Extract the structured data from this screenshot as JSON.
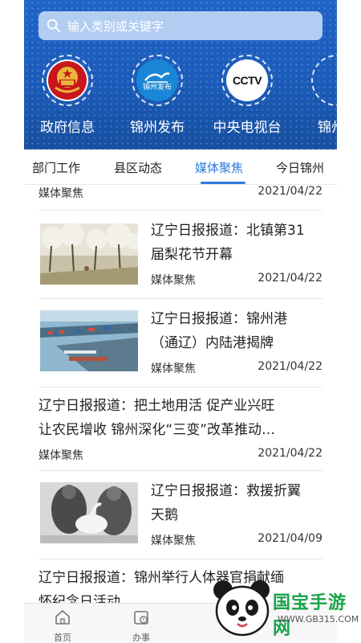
{
  "search": {
    "placeholder": "输入类别或关键字"
  },
  "channels": [
    {
      "label": "政府信息",
      "icon": "emblem-icon"
    },
    {
      "label": "锦州发布",
      "icon": "jinzhou-release-logo",
      "logo_text": "锦州发布"
    },
    {
      "label": "中央电视台",
      "icon": "cctv-logo",
      "logo_text": "CCTV"
    },
    {
      "label": "锦州"
    }
  ],
  "tabs": [
    {
      "label": "部门工作",
      "active": false
    },
    {
      "label": "县区动态",
      "active": false
    },
    {
      "label": "媒体聚焦",
      "active": true
    },
    {
      "label": "今日锦州",
      "active": false
    }
  ],
  "news": [
    {
      "title": "",
      "source": "媒体聚焦",
      "date": "2021/04/22",
      "has_image": false
    },
    {
      "title": "辽宁日报报道：北镇第31届梨花节开幕",
      "title_lines": [
        "辽宁日报报道：北镇第31",
        "届梨花节开幕"
      ],
      "source": "媒体聚焦",
      "date": "2021/04/22",
      "has_image": true,
      "image": "pear-orchard-photo"
    },
    {
      "title": "辽宁日报报道：锦州港（通辽）内陆港揭牌",
      "title_lines": [
        "辽宁日报报道：锦州港",
        "（通辽）内陆港揭牌"
      ],
      "source": "媒体聚焦",
      "date": "2021/04/22",
      "has_image": true,
      "image": "port-aerial-photo"
    },
    {
      "title": "辽宁日报报道：把土地用活 促产业兴旺 让农民增收 锦州深化“三变”改革推动…",
      "title_lines": [
        "辽宁日报报道：把土地用活 促产业兴旺",
        "让农民增收 锦州深化“三变”改革推动…"
      ],
      "source": "媒体聚焦",
      "date": "2021/04/22",
      "has_image": false
    },
    {
      "title": "辽宁日报报道：救援折翼天鹅",
      "title_lines": [
        "辽宁日报报道：救援折翼",
        "天鹅"
      ],
      "source": "媒体聚焦",
      "date": "2021/04/09",
      "has_image": true,
      "image": "swan-rescue-photo"
    },
    {
      "title": "辽宁日报报道：锦州举行人体器官捐献缅怀纪念日活动",
      "title_lines": [
        "辽宁日报报道：锦州举行人体器官捐献缅",
        "怀纪念日活动"
      ],
      "source": "",
      "date": "",
      "has_image": false
    }
  ],
  "bottom_nav": [
    {
      "label": "首页",
      "icon": "home-icon"
    },
    {
      "label": "办事",
      "icon": "service-icon"
    }
  ],
  "watermark": {
    "brand": "国宝手游网",
    "url": "WWW.GB315.COM"
  },
  "colors": {
    "header_blue": "#1b5bb9",
    "active_tab": "#2b7be0",
    "watermark_green": "#19a34a"
  }
}
